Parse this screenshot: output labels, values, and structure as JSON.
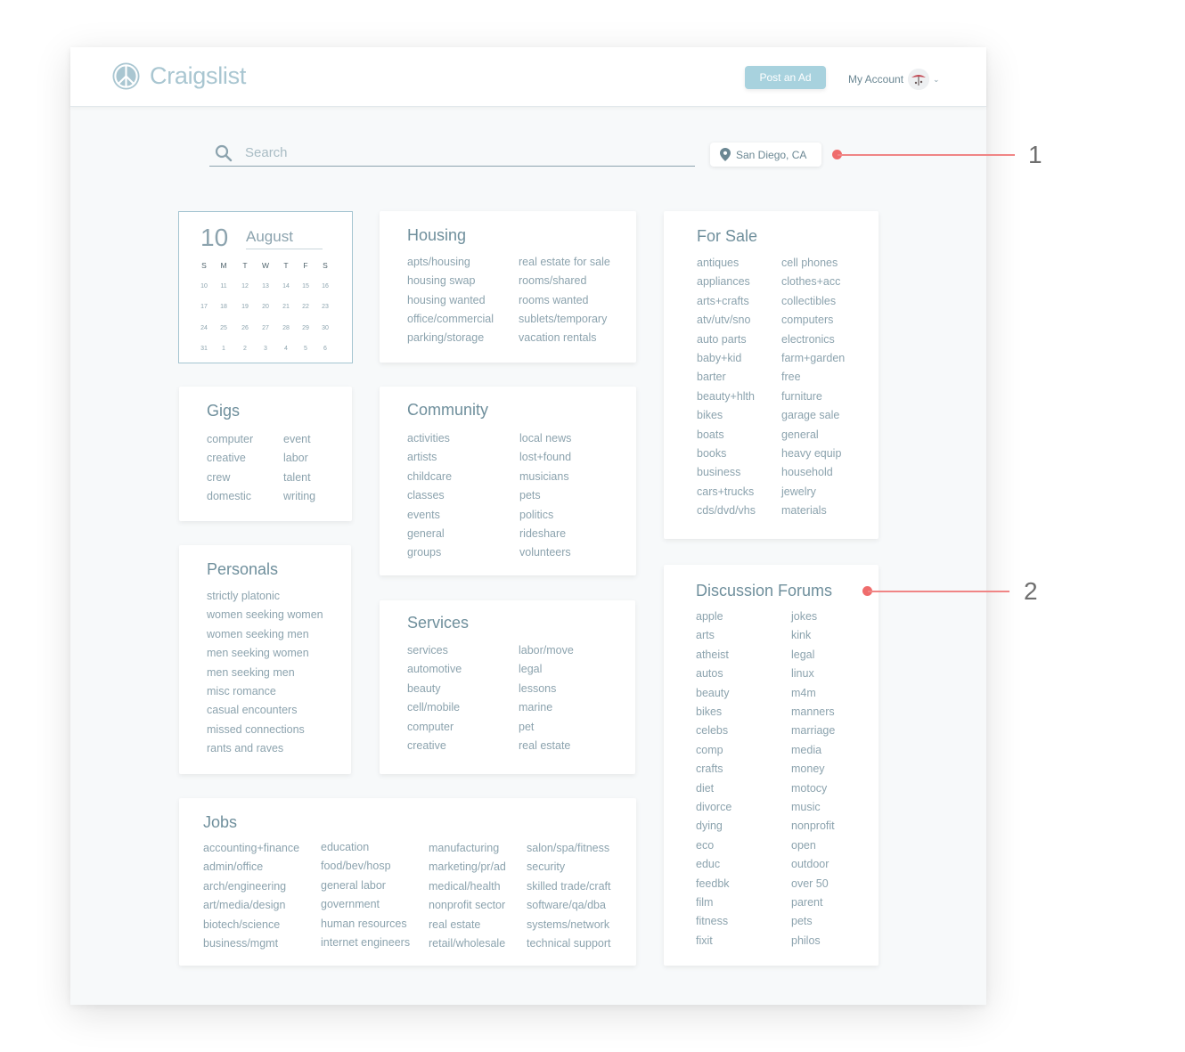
{
  "header": {
    "logo_text": "Craigslist",
    "post_button": "Post an Ad",
    "account_label": "My Account"
  },
  "search": {
    "placeholder": "Search",
    "location": "San Diego, CA"
  },
  "calendar": {
    "day": "10",
    "month": "August",
    "weekdays": [
      "S",
      "M",
      "T",
      "W",
      "T",
      "F",
      "S"
    ],
    "weeks": [
      [
        "10",
        "11",
        "12",
        "13",
        "14",
        "15",
        "16"
      ],
      [
        "17",
        "18",
        "19",
        "20",
        "21",
        "22",
        "23"
      ],
      [
        "24",
        "25",
        "26",
        "27",
        "28",
        "29",
        "30"
      ],
      [
        "31",
        "1",
        "2",
        "3",
        "4",
        "5",
        "6"
      ]
    ]
  },
  "sections": {
    "housing": {
      "title": "Housing",
      "col1": [
        "apts/housing",
        "housing swap",
        "housing wanted",
        "office/commercial",
        "parking/storage"
      ],
      "col2": [
        "real estate for sale",
        "rooms/shared",
        "rooms wanted",
        "sublets/temporary",
        "vacation rentals"
      ]
    },
    "for_sale": {
      "title": "For Sale",
      "col1": [
        "antiques",
        "appliances",
        "arts+crafts",
        "atv/utv/sno",
        "auto parts",
        "baby+kid",
        "barter",
        "beauty+hlth",
        "bikes",
        "boats",
        "books",
        "business",
        "cars+trucks",
        "cds/dvd/vhs"
      ],
      "col2": [
        "cell phones",
        "clothes+acc",
        "collectibles",
        "computers",
        "electronics",
        "farm+garden",
        "free",
        "furniture",
        "garage sale",
        "general",
        "heavy equip",
        "household",
        "jewelry",
        "materials"
      ]
    },
    "gigs": {
      "title": "Gigs",
      "col1": [
        "computer",
        "creative",
        "crew",
        "domestic"
      ],
      "col2": [
        "event",
        "labor",
        "talent",
        "writing"
      ]
    },
    "community": {
      "title": "Community",
      "col1": [
        "activities",
        "artists",
        "childcare",
        "classes",
        "events",
        "general",
        "groups"
      ],
      "col2": [
        "local news",
        "lost+found",
        "musicians",
        "pets",
        "politics",
        "rideshare",
        "volunteers"
      ]
    },
    "personals": {
      "title": "Personals",
      "col1": [
        "strictly platonic",
        "women seeking women",
        "women seeking men",
        "men seeking women",
        "men seeking men",
        "misc romance",
        "casual encounters",
        "missed connections",
        "rants and raves"
      ]
    },
    "services": {
      "title": "Services",
      "col1": [
        "services",
        "automotive",
        "beauty",
        "cell/mobile",
        "computer",
        "creative"
      ],
      "col2": [
        "labor/move",
        "legal",
        "lessons",
        "marine",
        "pet",
        "real estate"
      ]
    },
    "discussion": {
      "title": "Discussion Forums",
      "col1": [
        "apple",
        "arts",
        "atheist",
        "autos",
        "beauty",
        "bikes",
        "celebs",
        "comp",
        "crafts",
        "diet",
        "divorce",
        "dying",
        "eco",
        "educ",
        "feedbk",
        "film",
        "fitness",
        "fixit"
      ],
      "col2": [
        "jokes",
        "kink",
        "legal",
        "linux",
        "m4m",
        "manners",
        "marriage",
        "media",
        "money",
        "motocy",
        "music",
        "nonprofit",
        "open",
        "outdoor",
        "over 50",
        "parent",
        "pets",
        "philos"
      ]
    },
    "jobs": {
      "title": "Jobs",
      "col1": [
        "accounting+finance",
        "admin/office",
        "arch/engineering",
        "art/media/design",
        "biotech/science",
        "business/mgmt"
      ],
      "col2": [
        "education",
        "food/bev/hosp",
        "general labor",
        "government",
        "human resources",
        "internet engineers"
      ],
      "col3": [
        "manufacturing",
        "marketing/pr/ad",
        "medical/health",
        "nonprofit sector",
        "real estate",
        "retail/wholesale"
      ],
      "col4": [
        "salon/spa/fitness",
        "security",
        "skilled trade/craft",
        "software/qa/dba",
        "systems/network",
        "technical support"
      ]
    }
  },
  "annotations": [
    "1",
    "2"
  ]
}
